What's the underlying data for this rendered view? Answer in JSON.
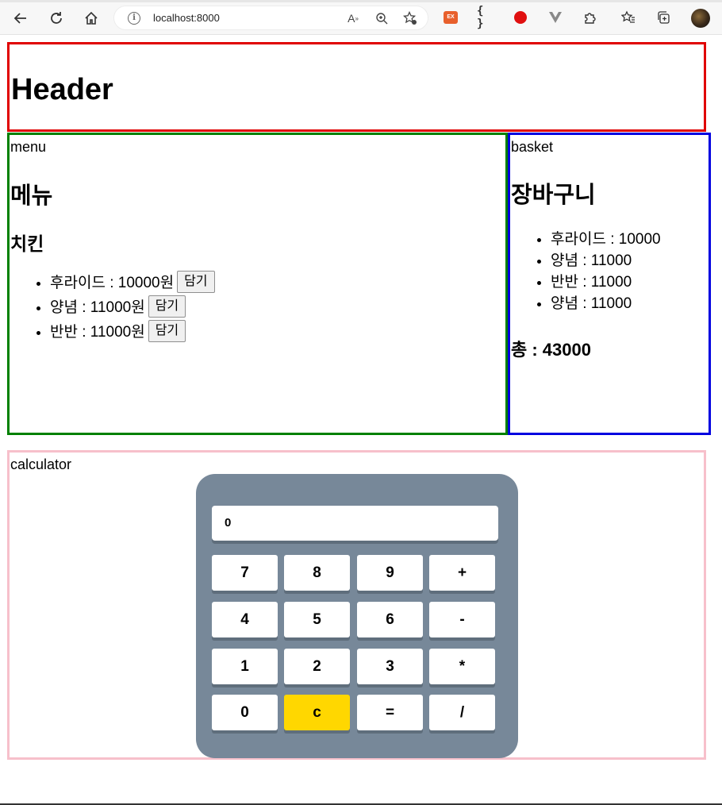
{
  "browser": {
    "url": "localhost:8000",
    "colors": {
      "chrome_bg": "#f7f7f7"
    }
  },
  "header": {
    "title": "Header"
  },
  "menu": {
    "label": "menu",
    "heading": "메뉴",
    "category": "치킨",
    "items": [
      {
        "text": "후라이드 : 10000원",
        "button": "담기"
      },
      {
        "text": "양념 : 11000원",
        "button": "담기"
      },
      {
        "text": "반반 : 11000원",
        "button": "담기"
      }
    ]
  },
  "basket": {
    "label": "basket",
    "heading": "장바구니",
    "items": [
      "후라이드 : 10000",
      "양념 : 11000",
      "반반 : 11000",
      "양념 : 11000"
    ],
    "total": "총 : 43000"
  },
  "calculator": {
    "label": "calculator",
    "display": "0",
    "keys": [
      [
        "7",
        "8",
        "9",
        "+"
      ],
      [
        "4",
        "5",
        "6",
        "-"
      ],
      [
        "1",
        "2",
        "3",
        "*"
      ],
      [
        "0",
        "c",
        "=",
        "/"
      ]
    ],
    "colors": {
      "body": "#778899",
      "clear_key": "#ffd700"
    }
  },
  "section_colors": {
    "header": "#e00000",
    "menu": "#008000",
    "basket": "#0000e0",
    "calculator": "#f7c0cb"
  }
}
